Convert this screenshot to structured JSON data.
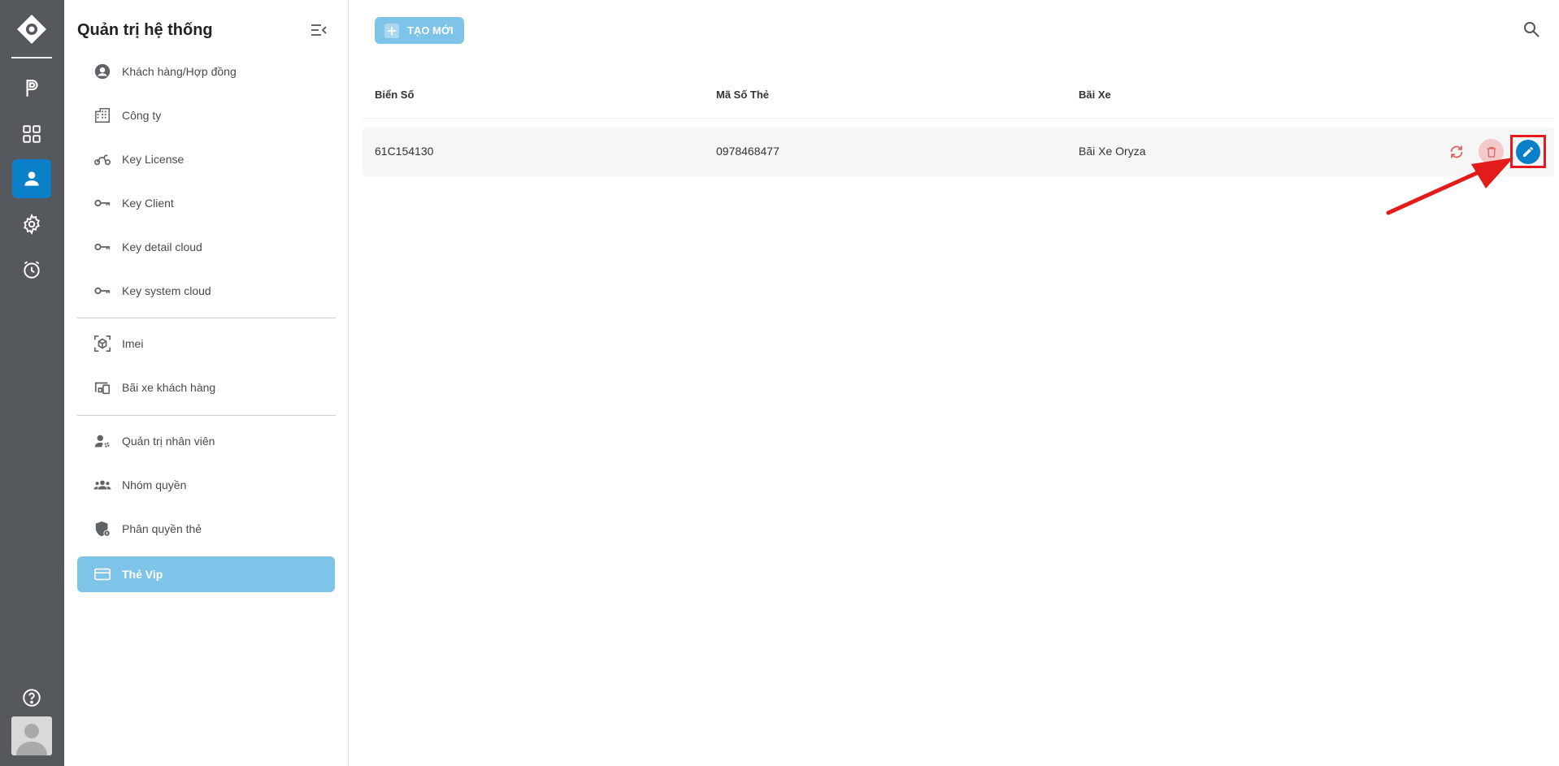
{
  "sidebar": {
    "title": "Quản trị hệ thống",
    "items": [
      {
        "label": "Khách hàng/Hợp đồng",
        "icon": "account-circle-icon"
      },
      {
        "label": "Công ty",
        "icon": "building-icon"
      },
      {
        "label": "Key License",
        "icon": "motorbike-icon"
      },
      {
        "label": "Key Client",
        "icon": "key-icon"
      },
      {
        "label": "Key detail cloud",
        "icon": "key-icon"
      },
      {
        "label": "Key system cloud",
        "icon": "key-icon"
      },
      {
        "label": "Imei",
        "icon": "cube-scan-icon"
      },
      {
        "label": "Bãi xe khách hàng",
        "icon": "devices-icon"
      },
      {
        "label": "Quản trị nhân viên",
        "icon": "user-gear-icon"
      },
      {
        "label": "Nhóm quyền",
        "icon": "group-icon"
      },
      {
        "label": "Phân quyền thẻ",
        "icon": "shield-lock-icon"
      },
      {
        "label": "Thẻ Vip",
        "icon": "credit-card-icon",
        "active": true
      }
    ]
  },
  "toolbar": {
    "new_label": "TẠO MỚI"
  },
  "table": {
    "columns": [
      "Biển Số",
      "Mã Số Thẻ",
      "Bãi Xe"
    ],
    "rows": [
      {
        "plate": "61C154130",
        "card": "0978468477",
        "lot": "Bãi Xe Oryza"
      }
    ]
  },
  "colors": {
    "rail": "#55585d",
    "accent": "#0b7fc7",
    "accent_light": "#7ec3e8",
    "danger": "#e31b1b"
  }
}
